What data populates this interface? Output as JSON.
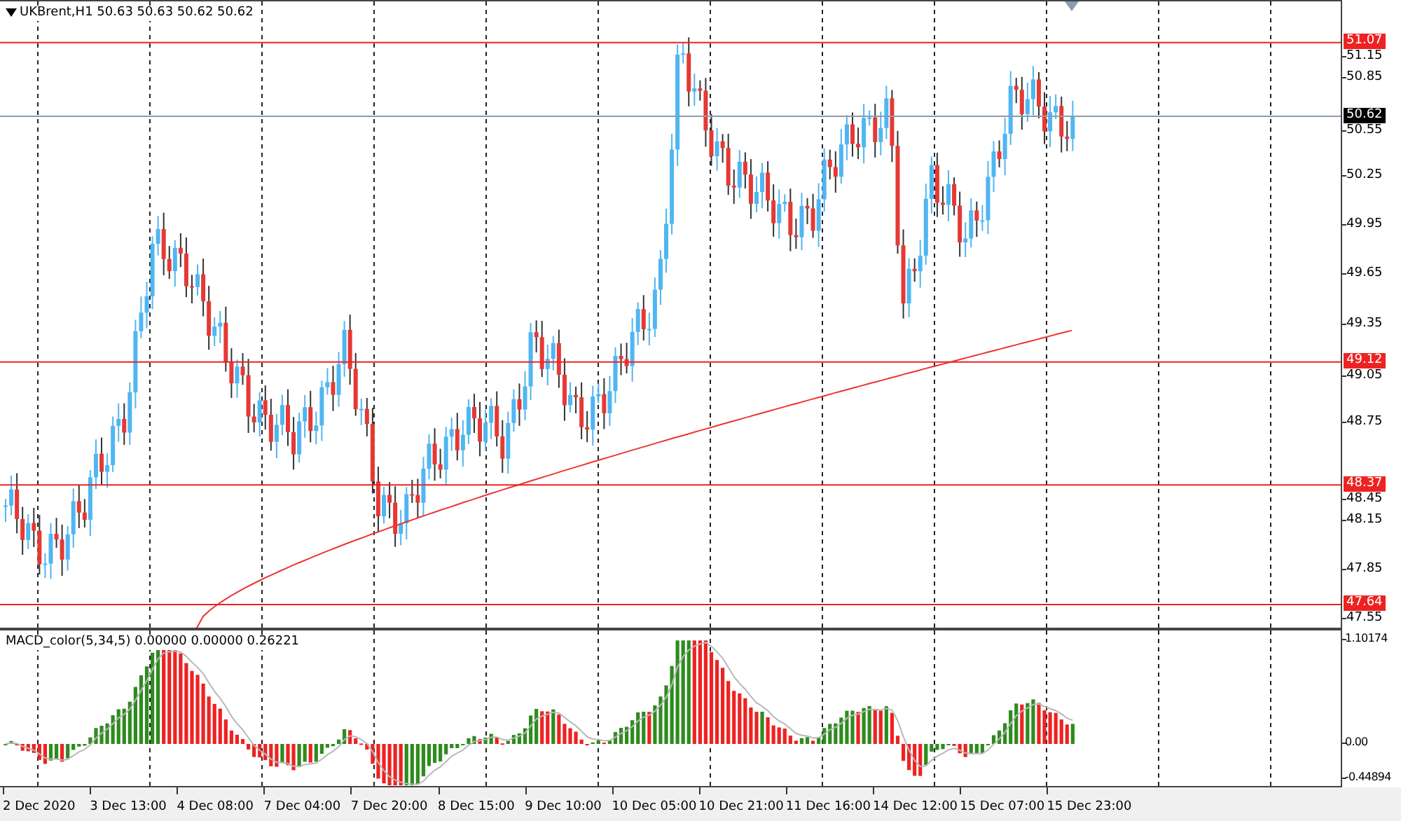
{
  "chart": {
    "title": "UKBrent,H1 50.63 50.63 50.62 50.62",
    "price_ticks": [
      "51.15",
      "50.85",
      "50.55",
      "50.25",
      "49.95",
      "49.65",
      "49.35",
      "49.05",
      "48.75",
      "48.45",
      "48.15",
      "47.85",
      "47.55"
    ],
    "levels": [
      {
        "kind": "level",
        "label": "51.07"
      },
      {
        "kind": "bid",
        "label": "50.62"
      },
      {
        "kind": "level",
        "label": "49.12"
      },
      {
        "kind": "level",
        "label": "48.37"
      },
      {
        "kind": "level",
        "label": "47.64"
      }
    ]
  },
  "indicator": {
    "title": "MACD_color(5,34,5) 0.00000 0.00000 0.26221",
    "ticks": [
      "1.10174",
      "0.00",
      "-0.44894"
    ]
  },
  "time_axis": [
    "2 Dec 2020",
    "3 Dec 13:00",
    "4 Dec 08:00",
    "7 Dec 04:00",
    "7 Dec 20:00",
    "8 Dec 15:00",
    "9 Dec 10:00",
    "10 Dec 05:00",
    "10 Dec 21:00",
    "11 Dec 16:00",
    "14 Dec 12:00",
    "15 Dec 07:00",
    "15 Dec 23:00"
  ]
}
